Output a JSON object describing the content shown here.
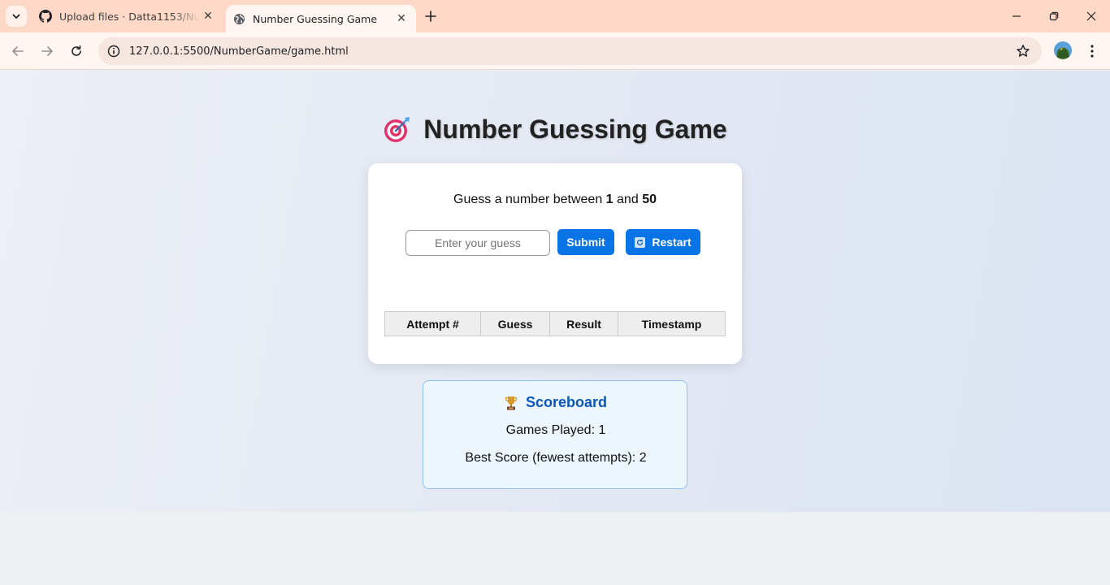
{
  "browser": {
    "tabs": [
      {
        "title": "Upload files · Datta1153/Number",
        "icon": "github-icon",
        "active": false
      },
      {
        "title": "Number Guessing Game",
        "icon": "globe-icon",
        "active": true
      }
    ],
    "url": "127.0.0.1:5500/NumberGame/game.html"
  },
  "game": {
    "title": "Number Guessing Game",
    "prompt_prefix": "Guess a number between",
    "range_min": "1",
    "prompt_and": "and",
    "range_max": "50",
    "input_placeholder": "Enter your guess",
    "input_value": "",
    "submit_label": "Submit",
    "restart_label": "Restart",
    "table_headers": [
      "Attempt #",
      "Guess",
      "Result",
      "Timestamp"
    ],
    "rows": []
  },
  "scoreboard": {
    "title": "Scoreboard",
    "games_played": "Games Played: 1",
    "best_score": "Best Score (fewest attempts): 2"
  },
  "colors": {
    "accent": "#0874e6",
    "scoreboard_title": "#0b57b8",
    "tab_strip": "#ffd9c7"
  }
}
